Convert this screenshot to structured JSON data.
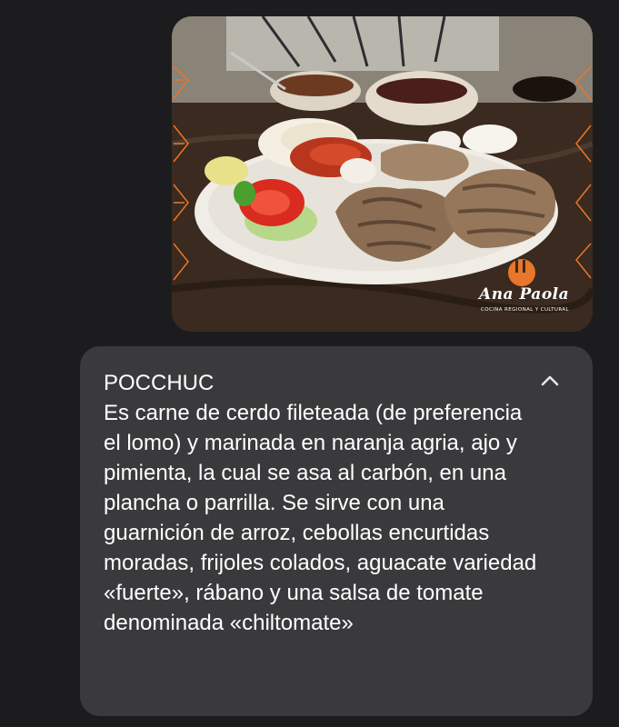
{
  "photo": {
    "logo_name": "Ana Paola",
    "logo_subtitle": "COCINA REGIONAL Y CULTURAL"
  },
  "message": {
    "title": "POCCHUC",
    "body": "Es carne de cerdo fileteada (de preferencia el lomo) y marinada en naranja agria, ajo y pimienta, la cual se asa al carbón, en una plancha o parrilla. Se sirve con una guarnición de arroz, cebollas encurtidas moradas, frijoles colados, aguacate variedad «fuerte», rábano y una salsa de tomate denominada «chiltomate»"
  },
  "colors": {
    "background": "#1c1c1e",
    "bubble": "#3a3a3c",
    "text": "#ffffff",
    "logo_accent": "#e8762b"
  },
  "icons": {
    "collapse": "chevron-up-icon"
  }
}
